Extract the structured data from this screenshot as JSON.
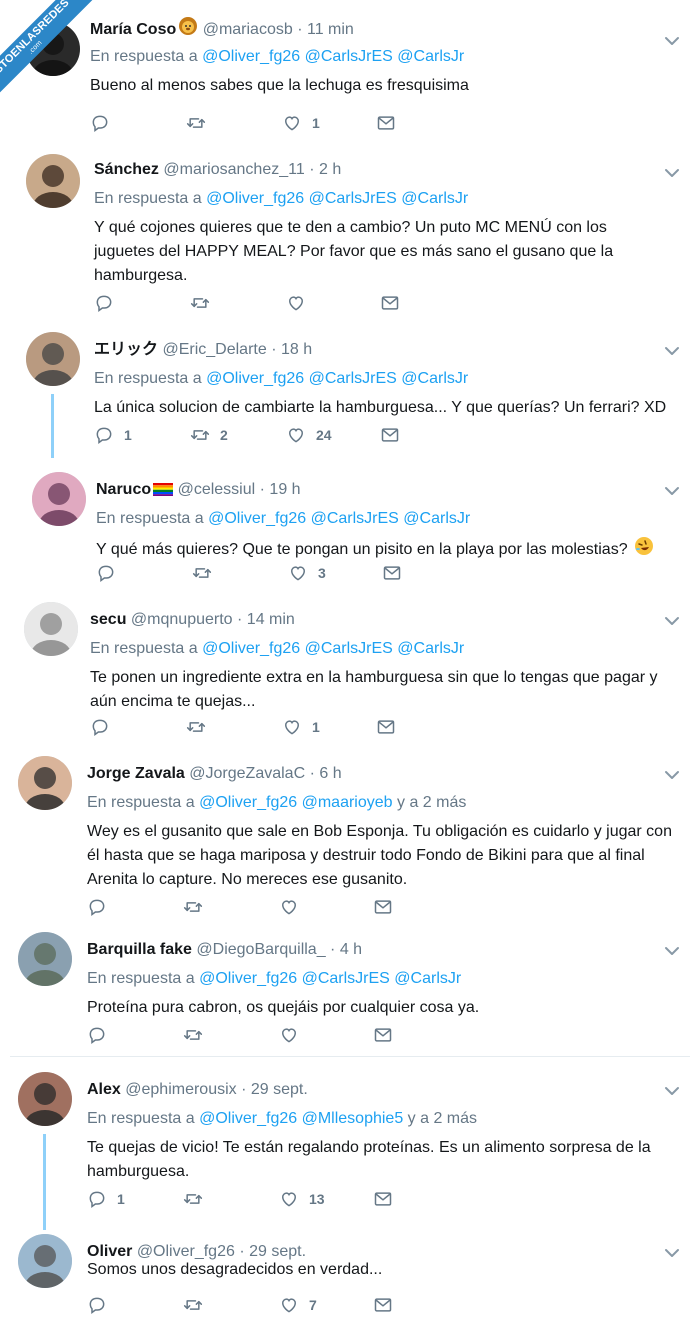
{
  "watermark": {
    "main": "VISTOENLASREDES",
    "sub": ".com"
  },
  "tweets": [
    {
      "name": "María Coso",
      "emoji": "lion-face",
      "handle": "@mariacosb",
      "sep": "·",
      "time": "11 min",
      "reply_prefix": "En respuesta a",
      "mentions": [
        "@Oliver_fg26",
        "@CarlsJrES",
        "@CarlsJr"
      ],
      "text": "Bueno al menos sabes que la lechuga es fresquisima",
      "counts": {
        "reply": "",
        "retweet": "",
        "like": "1"
      }
    },
    {
      "name": "Sánchez",
      "handle": "@mariosanchez_11",
      "sep": "·",
      "time": "2 h",
      "reply_prefix": "En respuesta a",
      "mentions": [
        "@Oliver_fg26",
        "@CarlsJrES",
        "@CarlsJr"
      ],
      "text": "Y qué cojones quieres que te den a cambio? Un puto MC MENÚ con los juguetes del HAPPY MEAL? Por favor que es más sano el gusano que la hamburgesa.",
      "counts": {
        "reply": "",
        "retweet": "",
        "like": ""
      }
    },
    {
      "name": "エリック",
      "handle": "@Eric_Delarte",
      "sep": "·",
      "time": "18 h",
      "reply_prefix": "En respuesta a",
      "mentions": [
        "@Oliver_fg26",
        "@CarlsJrES",
        "@CarlsJr"
      ],
      "text": "La única solucion de cambiarte la hamburguesa... Y que querías? Un ferrari? XD",
      "counts": {
        "reply": "1",
        "retweet": "2",
        "like": "24"
      }
    },
    {
      "name": "Naruco",
      "emoji": "rainbow-flag",
      "handle": "@celessiul",
      "sep": "·",
      "time": "19 h",
      "reply_prefix": "En respuesta a",
      "mentions": [
        "@Oliver_fg26",
        "@CarlsJrES",
        "@CarlsJr"
      ],
      "text": "Y qué más quieres? Que te pongan un pisito en la playa por las molestias?",
      "text_emoji": "rolling-laughing-face",
      "counts": {
        "reply": "",
        "retweet": "",
        "like": "3"
      }
    },
    {
      "name": "secu",
      "handle": "@mqnupuerto",
      "sep": "·",
      "time": "14 min",
      "reply_prefix": "En respuesta a",
      "mentions": [
        "@Oliver_fg26",
        "@CarlsJrES",
        "@CarlsJr"
      ],
      "text": "Te ponen un ingrediente extra en la hamburguesa sin que lo tengas que pagar y aún encima te quejas...",
      "counts": {
        "reply": "",
        "retweet": "",
        "like": "1"
      }
    },
    {
      "name": "Jorge Zavala",
      "handle": "@JorgeZavalaC",
      "sep": "·",
      "time": "6 h",
      "reply_prefix": "En respuesta a",
      "mentions": [
        "@Oliver_fg26",
        "@maarioyeb"
      ],
      "reply_suffix": "y a 2 más",
      "text": "Wey es el gusanito que sale en Bob Esponja. Tu obligación es cuidarlo y jugar con él hasta que se haga mariposa y destruir todo Fondo de Bikini para que al final Arenita lo capture. No mereces ese gusanito.",
      "counts": {
        "reply": "",
        "retweet": "",
        "like": ""
      }
    },
    {
      "name": "Barquilla fake",
      "handle": "@DiegoBarquilla_",
      "sep": "·",
      "time": "4 h",
      "reply_prefix": "En respuesta a",
      "mentions": [
        "@Oliver_fg26",
        "@CarlsJrES",
        "@CarlsJr"
      ],
      "text": "Proteína pura cabron, os quejáis por cualquier cosa ya.",
      "counts": {
        "reply": "",
        "retweet": "",
        "like": ""
      }
    },
    {
      "name": "Alex",
      "handle": "@ephimerousix",
      "sep": "·",
      "time": "29 sept.",
      "reply_prefix": "En respuesta a",
      "mentions": [
        "@Oliver_fg26",
        "@Mllesophie5"
      ],
      "reply_suffix": "y a 2 más",
      "text": "Te quejas de vicio! Te están regalando proteínas. Es un alimento sorpresa de la hamburguesa.",
      "counts": {
        "reply": "1",
        "retweet": "",
        "like": "13"
      }
    },
    {
      "name": "Oliver",
      "handle": "@Oliver_fg26",
      "sep": "·",
      "time": "29 sept.",
      "text": "Somos unos desagradecidos en verdad...",
      "counts": {
        "reply": "",
        "retweet": "",
        "like": "7"
      }
    }
  ],
  "colors": {
    "mention": "#1da1f2",
    "muted": "#657786",
    "thread": "#8ed0f9",
    "watermark": "#2c87c8"
  },
  "icons": {
    "reply": "reply-icon",
    "retweet": "retweet-icon",
    "like": "like-icon",
    "message": "message-icon",
    "more": "chevron-down-icon"
  }
}
